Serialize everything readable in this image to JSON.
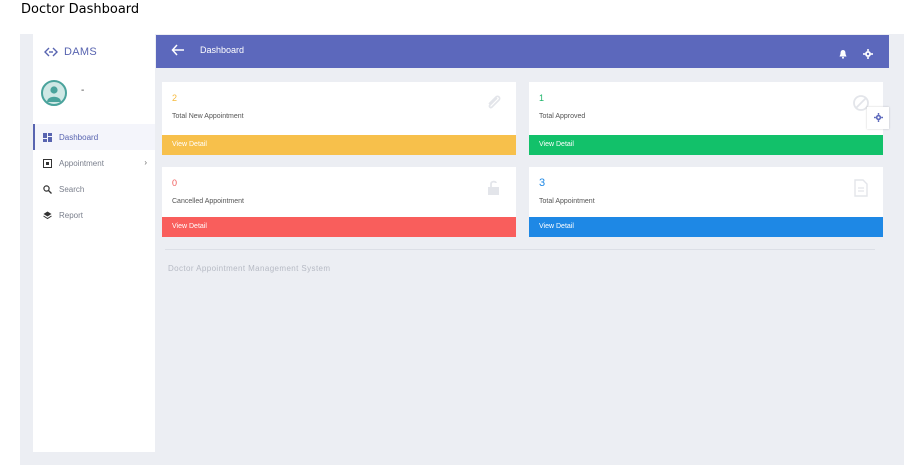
{
  "page_caption": "Doctor Dashboard",
  "brand": {
    "name": "DAMS",
    "icon": "code-brackets-icon"
  },
  "profile": {
    "name": "-",
    "icon": "user-avatar-icon"
  },
  "nav": [
    {
      "label": "Dashboard",
      "icon": "grid-icon",
      "active": true
    },
    {
      "label": "Appointment",
      "icon": "calendar-box-icon",
      "has_submenu": true
    },
    {
      "label": "Search",
      "icon": "search-icon"
    },
    {
      "label": "Report",
      "icon": "layers-icon"
    }
  ],
  "header": {
    "title": "Dashboard",
    "icons": [
      "back-arrow-icon",
      "bell-icon",
      "gear-icon"
    ]
  },
  "cards": [
    {
      "count": "2",
      "label": "Total New Appointment",
      "link": "View Detail",
      "count_color": "#f6b93b",
      "footer_color": "#f7c04b",
      "icon": "paperclip-icon"
    },
    {
      "count": "1",
      "label": "Total Approved",
      "link": "View Detail",
      "count_color": "#1fb56b",
      "footer_color": "#12c16a",
      "icon": "ban-icon"
    },
    {
      "count": "0",
      "label": "Cancelled Appointment",
      "link": "View Detail",
      "count_color": "#f05a5a",
      "footer_color": "#f95e5c",
      "icon": "unlock-icon"
    },
    {
      "count": "3",
      "label": "Total Appointment",
      "link": "View Detail",
      "count_color": "#1e88e5",
      "footer_color": "#1e88e5",
      "icon": "file-icon"
    }
  ],
  "footer_text": "Doctor Appointment Management System",
  "colors": {
    "primary": "#5c68bc",
    "background": "#eceef3"
  }
}
